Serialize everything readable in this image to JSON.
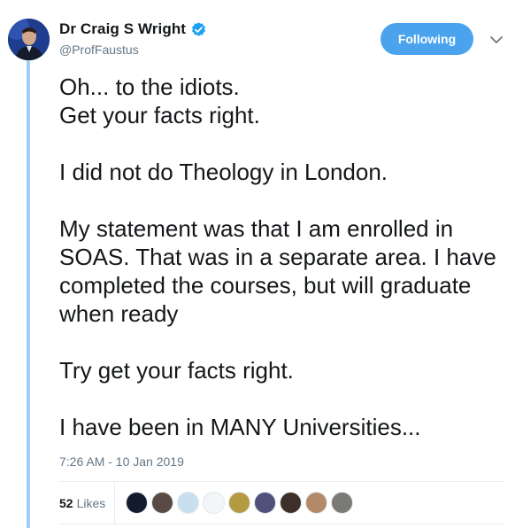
{
  "tweet": {
    "author": {
      "display_name": "Dr Craig S Wright",
      "handle": "@ProfFaustus",
      "verified": true
    },
    "follow_label": "Following",
    "body_paragraphs": [
      "Oh... to the idiots.\nGet your facts right.",
      "I did not do Theology in London.",
      "My statement was that I am enrolled in SOAS. That was in a separate area. I have completed the courses, but will graduate when ready",
      "Try get your facts right.",
      "I have been in MANY Universities..."
    ],
    "timestamp": "7:26 AM - 10 Jan 2019",
    "likes": {
      "count": "52",
      "label": "Likes"
    },
    "likers": [
      {
        "color": "#141a2e"
      },
      {
        "color": "#5a4a44"
      },
      {
        "color": "#c8dff0"
      },
      {
        "color": "#f3f6f8"
      },
      {
        "color": "#b59a42"
      },
      {
        "color": "#51507a"
      },
      {
        "color": "#3e2f28"
      },
      {
        "color": "#b28a6a"
      },
      {
        "color": "#7c7a76"
      }
    ]
  },
  "colors": {
    "accent": "#4ba3ee",
    "verified": "#1da1f2",
    "thread_line": "#9ed0f7",
    "muted_text": "#657786"
  }
}
